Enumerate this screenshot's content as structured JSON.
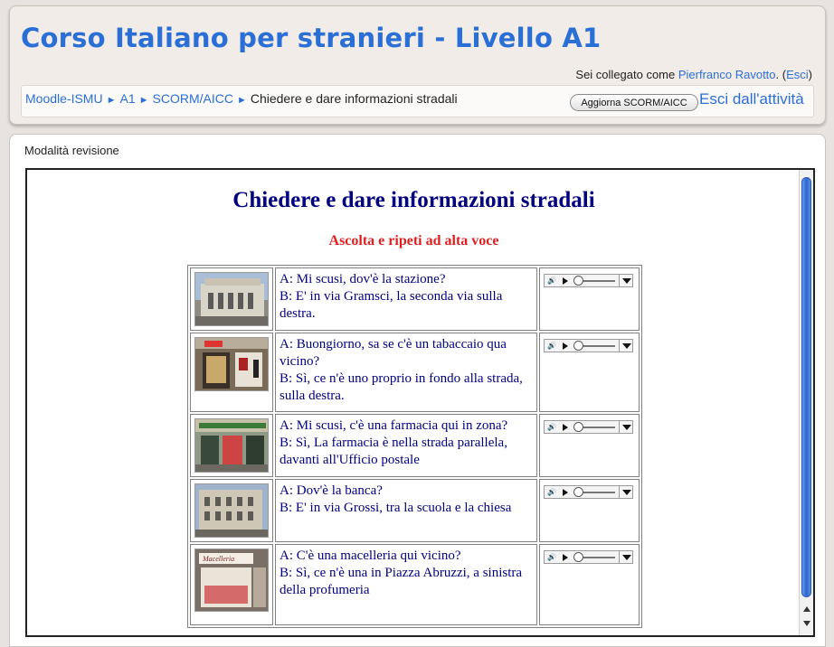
{
  "header": {
    "site_title": "Corso Italiano per stranieri - Livello A1",
    "login_prefix": "Sei collegato come ",
    "user_name": "Pierfranco Ravotto",
    "login_mid": ". (",
    "logout_label": "Esci",
    "login_suffix": ")"
  },
  "breadcrumb": {
    "items": [
      "Moodle-ISMU",
      "A1",
      "SCORM/AICC"
    ],
    "separator": "►",
    "current": "Chiedere e dare informazioni stradali"
  },
  "actions": {
    "update_button": "Aggiorna SCORM/AICC",
    "exit_activity": "Esci dall'attività"
  },
  "main": {
    "mode_label": "Modalità revisione",
    "lesson_title": "Chiedere e dare informazioni stradali",
    "lesson_subtitle": "Ascolta e ripeti ad alta voce",
    "rows": [
      {
        "image": "station-photo",
        "line1": "A: Mi scusi, dov'è la stazione?",
        "line2": "B: E' in via Gramsci, la seconda via sulla destra."
      },
      {
        "image": "tobacconist-photo",
        "line1": "A: Buongiorno, sa se c'è un tabaccaio qua vicino?",
        "line2": "B: Sì, ce n'è uno proprio in fondo alla strada, sulla destra."
      },
      {
        "image": "pharmacy-photo",
        "line1": "A: Mi scusi, c'è una farmacia qui in zona?",
        "line2": "B: Sì, La farmacia è nella strada parallela, davanti all'Ufficio postale"
      },
      {
        "image": "bank-photo",
        "line1": "A: Dov'è la banca?",
        "line2": "B: E' in via Grossi, tra la scuola e la chiesa"
      },
      {
        "image": "butcher-photo",
        "line1": "A: C'è una macelleria qui vicino?",
        "line2": "B: Sì, ce n'è una in Piazza Abruzzi, a sinistra della profumeria"
      }
    ],
    "butcher_sign": "Macelleria"
  },
  "colors": {
    "title_blue": "#2a6fd6",
    "dialogue_navy": "#000080",
    "subtitle_red": "#e02020"
  }
}
